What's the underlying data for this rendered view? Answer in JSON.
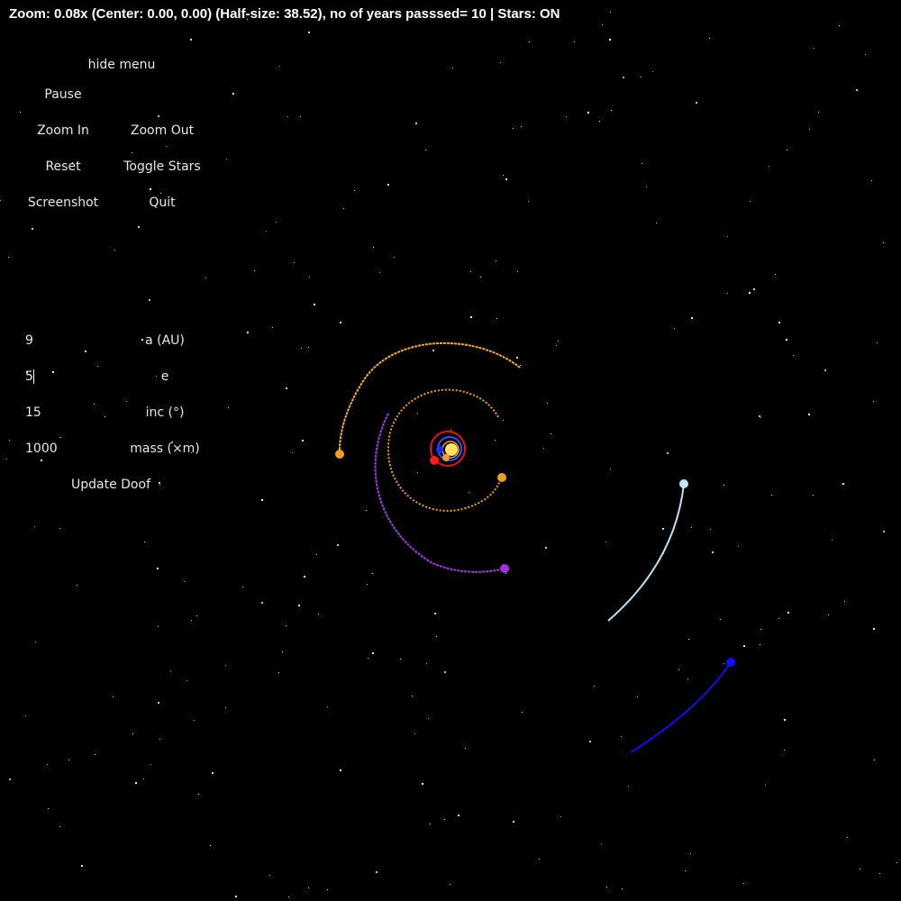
{
  "status": {
    "text": "Zoom: 0.08x (Center: 0.00, 0.00) (Half-size: 38.52), no of years passsed= 10 | Stars: ON"
  },
  "menu": {
    "hide_menu": "hide menu",
    "pause": "Pause",
    "zoom_in": "Zoom In",
    "zoom_out": "Zoom Out",
    "reset": "Reset",
    "toggle_stars": "Toggle Stars",
    "screenshot": "Screenshot",
    "quit": "Quit"
  },
  "form": {
    "fields": [
      {
        "value": "9",
        "label": "a (AU)"
      },
      {
        "value": "5",
        "label": "e"
      },
      {
        "value": "15",
        "label": "inc (°)"
      },
      {
        "value": "1000",
        "label": "mass (×m⁮)"
      }
    ],
    "update_button": "Update Doof"
  },
  "colors": {
    "background": "#000000",
    "sun": "#ffd84a",
    "red_orbit": "#e01818",
    "orange_trail": "#f0a030",
    "purple_trail": "#a040e0",
    "lightblue_trail": "#b0e0f0",
    "blue_trail": "#1010e8"
  }
}
